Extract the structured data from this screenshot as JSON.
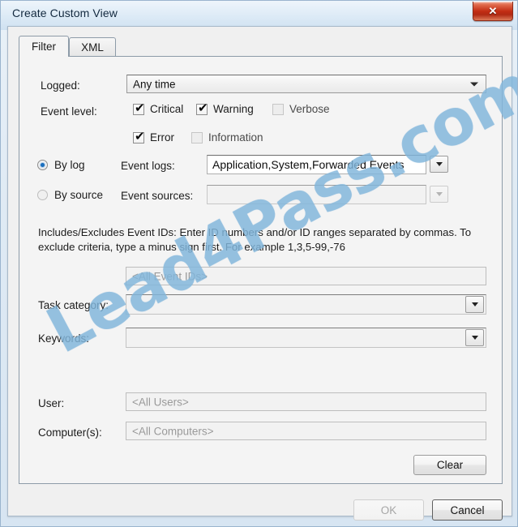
{
  "window": {
    "title": "Create Custom View",
    "close_icon": "close-icon",
    "close_glyph": "✕"
  },
  "tabs": [
    {
      "label": "Filter",
      "active": true
    },
    {
      "label": "XML",
      "active": false
    }
  ],
  "filter": {
    "logged": {
      "label": "Logged:",
      "value": "Any time",
      "arrow_icon": "chevron-down-icon"
    },
    "event_level": {
      "label": "Event level:",
      "options": [
        {
          "label": "Critical",
          "checked": true
        },
        {
          "label": "Warning",
          "checked": true
        },
        {
          "label": "Verbose",
          "checked": false
        },
        {
          "label": "Error",
          "checked": true
        },
        {
          "label": "Information",
          "checked": false
        }
      ],
      "check_glyph": "✔"
    },
    "source_mode": {
      "by_log": {
        "label": "By log",
        "selected": true
      },
      "by_source": {
        "label": "By source",
        "selected": false
      }
    },
    "event_logs": {
      "label": "Event logs:",
      "value": "Application,System,Forwarded Events",
      "enabled": true,
      "arrow_icon": "chevron-down-icon"
    },
    "event_sources": {
      "label": "Event sources:",
      "value": "",
      "enabled": false,
      "arrow_icon": "chevron-down-icon"
    },
    "event_ids": {
      "description": "Includes/Excludes Event IDs: Enter ID numbers and/or ID ranges separated by commas. To exclude criteria, type a minus sign first. For example 1,3,5-99,-76",
      "placeholder": "<All Event IDs>",
      "value": ""
    },
    "task_category": {
      "label": "Task category:",
      "value": "",
      "arrow_icon": "chevron-down-icon"
    },
    "keywords": {
      "label": "Keywords:",
      "value": "",
      "arrow_icon": "chevron-down-icon"
    },
    "user": {
      "label": "User:",
      "placeholder": "<All Users>",
      "value": ""
    },
    "computers": {
      "label": "Computer(s):",
      "placeholder": "<All Computers>",
      "value": ""
    },
    "clear_button": "Clear"
  },
  "footer": {
    "ok_button": "OK",
    "ok_enabled": false,
    "cancel_button": "Cancel"
  },
  "watermark": {
    "text": "Lead4Pass.com",
    "color": "#81b6db"
  }
}
